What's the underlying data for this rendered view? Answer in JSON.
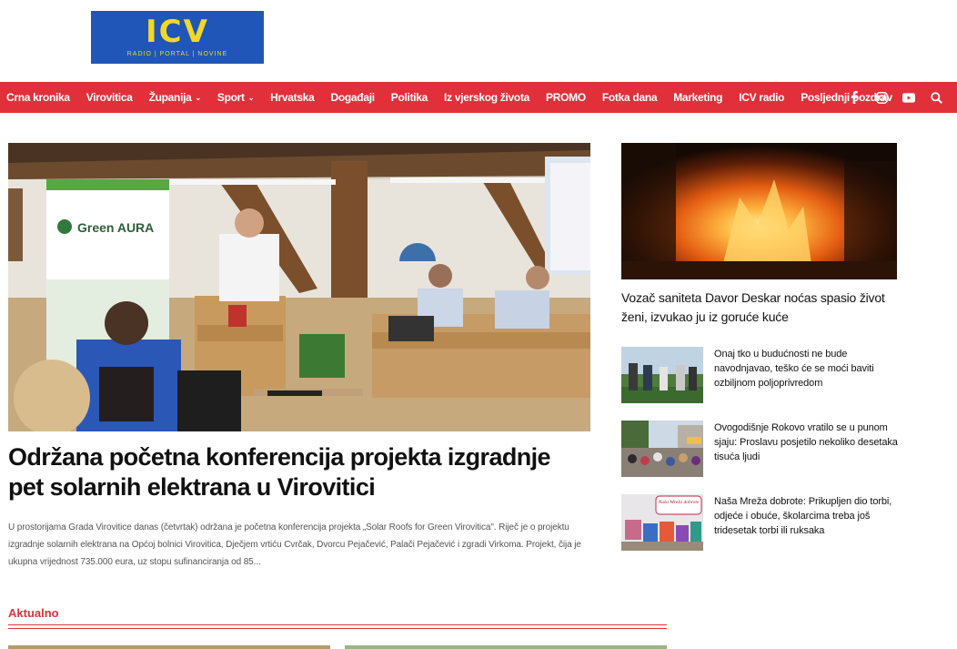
{
  "logo": {
    "text": "ICV",
    "tagline": "RADIO | PORTAL | NOVINE"
  },
  "nav": {
    "items": [
      {
        "label": "Crna kronika",
        "dropdown": false
      },
      {
        "label": "Virovitica",
        "dropdown": false
      },
      {
        "label": "Županija",
        "dropdown": true
      },
      {
        "label": "Sport",
        "dropdown": true
      },
      {
        "label": "Hrvatska",
        "dropdown": false
      },
      {
        "label": "Događaji",
        "dropdown": false
      },
      {
        "label": "Politika",
        "dropdown": false
      },
      {
        "label": "Iz vjerskog života",
        "dropdown": false
      },
      {
        "label": "PROMO",
        "dropdown": false
      },
      {
        "label": "Fotka dana",
        "dropdown": false
      },
      {
        "label": "Marketing",
        "dropdown": false
      },
      {
        "label": "ICV radio",
        "dropdown": false
      },
      {
        "label": "Posljednji pozdrav",
        "dropdown": false
      }
    ],
    "icons": [
      "facebook-icon",
      "instagram-icon",
      "youtube-icon",
      "search-icon"
    ],
    "background": "#e2303a"
  },
  "main_article": {
    "image_text": "Green AURA",
    "title": "Održana početna konferencija projekta izgradnje pet solarnih elektrana u Virovitici",
    "excerpt": "U prostorijama Grada Virovitice danas (četvrtak) održana je početna konferencija projekta „Solar Roofs for Green Virovitica\". Riječ je o projektu izgradnje solarnih elektrana na Općoj bolnici Virovitica, Dječjem vrtiću Cvrčak, Dvorcu Pejačević, Palači Pejačević i zgradi Virkoma. Projekt, čija je ukupna vrijednost 735.000 eura, uz stopu sufinanciranja od 85..."
  },
  "section": {
    "title": "Aktualno",
    "accent": "#e2303a"
  },
  "sidebar": {
    "featured": {
      "title": "Vozač saniteta Davor Deskar noćas spasio život ženi, izvukao ju iz goruće kuće"
    },
    "items": [
      {
        "title": "Onaj tko u budućnosti ne bude navodnjavao, teško će se moći baviti ozbiljnom poljoprivredom"
      },
      {
        "title": "Ovogodišnje Rokovo vratilo se u punom sjaju: Proslavu posjetilo nekoliko desetaka tisuća ljudi"
      },
      {
        "title": "Naša Mreža dobrote: Prikupljen dio torbi, odjeće i obuće, školarcima treba još tridesetak torbi ili ruksaka",
        "image_text": "Naša Mreža dobrote"
      }
    ]
  }
}
